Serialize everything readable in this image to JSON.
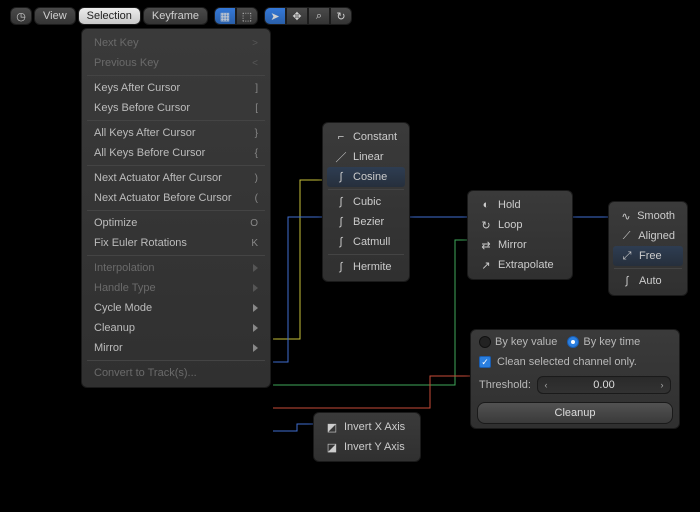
{
  "toolbar": {
    "view": "View",
    "selection": "Selection",
    "keyframe": "Keyframe"
  },
  "menu": {
    "next_key": "Next Key",
    "next_key_sc": ">",
    "prev_key": "Previous Key",
    "prev_key_sc": "<",
    "keys_after": "Keys After Cursor",
    "keys_after_sc": "]",
    "keys_before": "Keys Before Cursor",
    "keys_before_sc": "[",
    "all_after": "All Keys After Cursor",
    "all_after_sc": "}",
    "all_before": "All Keys Before Cursor",
    "all_before_sc": "{",
    "next_act": "Next Actuator After Cursor",
    "next_act_sc": ")",
    "prev_act": "Next Actuator Before Cursor",
    "prev_act_sc": "(",
    "optimize": "Optimize",
    "optimize_sc": "O",
    "fix_euler": "Fix Euler Rotations",
    "fix_euler_sc": "K",
    "interpolation": "Interpolation",
    "handle_type": "Handle Type",
    "cycle_mode": "Cycle Mode",
    "cleanup": "Cleanup",
    "mirror": "Mirror",
    "convert": "Convert to Track(s)..."
  },
  "interp": {
    "constant": "Constant",
    "linear": "Linear",
    "cosine": "Cosine",
    "cubic": "Cubic",
    "bezier": "Bezier",
    "catmull": "Catmull",
    "hermite": "Hermite"
  },
  "cycle": {
    "hold": "Hold",
    "loop": "Loop",
    "mirror": "Mirror",
    "extrapolate": "Extrapolate"
  },
  "handle": {
    "smooth": "Smooth",
    "aligned": "Aligned",
    "free": "Free",
    "auto": "Auto"
  },
  "mirror_sub": {
    "invert_x": "Invert X Axis",
    "invert_y": "Invert Y Axis"
  },
  "cleanup_sub": {
    "by_value": "By key value",
    "by_time": "By key time",
    "clean_sel": "Clean selected channel only.",
    "threshold_label": "Threshold:",
    "threshold_value": "0.00",
    "button": "Cleanup"
  }
}
